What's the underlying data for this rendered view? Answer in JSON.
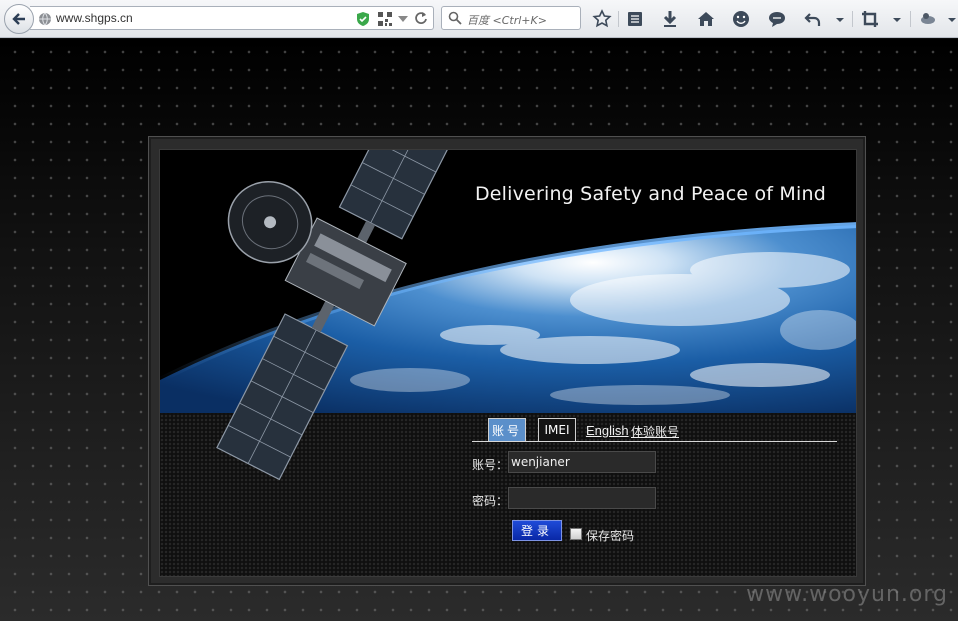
{
  "browser": {
    "url": "www.shgps.cn",
    "search_placeholder": "百度 <Ctrl+K>"
  },
  "hero": {
    "tagline": "Delivering Safety and Peace of Mind"
  },
  "login": {
    "tabs": [
      {
        "label": "账号"
      },
      {
        "label": "IMEI"
      }
    ],
    "links": [
      {
        "label": "English"
      },
      {
        "label": "体验账号"
      }
    ],
    "account_label": "账号：",
    "account_value": "wenjianer",
    "password_label": "密码：",
    "password_value": "",
    "login_button": "登录",
    "save_password_label": "保存密码"
  },
  "watermark": "www.wooyun.org",
  "colors": {
    "accent_tab": "#5b8fca",
    "login_button": "#1036c0"
  }
}
